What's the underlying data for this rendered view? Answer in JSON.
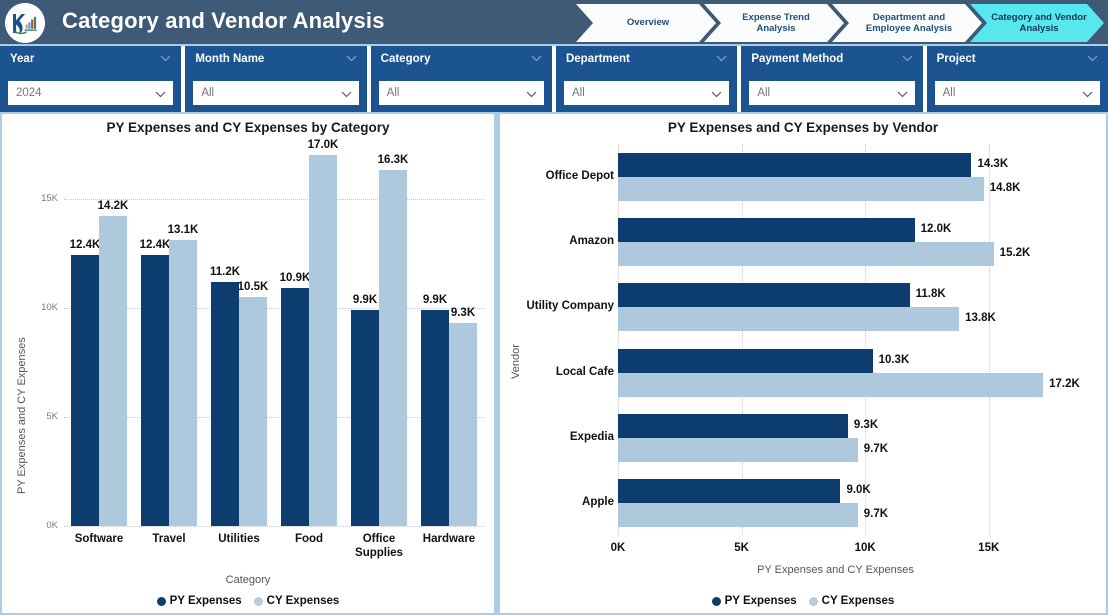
{
  "header": {
    "title": "Category and Vendor Analysis",
    "logo_icon": "kr-analytics-logo-icon",
    "background": "#3f5a77"
  },
  "nav": {
    "tabs": [
      {
        "label": "Overview",
        "active": false
      },
      {
        "label": "Expense Trend\nAnalysis",
        "active": false
      },
      {
        "label": "Department and\nEmployee Analysis",
        "active": false
      },
      {
        "label": "Category and\nVendor Analysis",
        "active": true
      }
    ],
    "active_color": "#56e8ee",
    "inactive_color": "#fbfcfc"
  },
  "slicers": [
    {
      "name": "year",
      "title": "Year",
      "value": "2024",
      "placeholder": "All",
      "chevron_icon": "chevron-down-icon"
    },
    {
      "name": "month-name",
      "title": "Month Name",
      "value": "All",
      "placeholder": "All",
      "chevron_icon": "chevron-down-icon"
    },
    {
      "name": "category",
      "title": "Category",
      "value": "All",
      "placeholder": "All",
      "chevron_icon": "chevron-down-icon"
    },
    {
      "name": "department",
      "title": "Department",
      "value": "All",
      "placeholder": "All",
      "chevron_icon": "chevron-down-icon"
    },
    {
      "name": "payment-method",
      "title": "Payment Method",
      "value": "All",
      "placeholder": "All",
      "chevron_icon": "chevron-down-icon"
    },
    {
      "name": "project",
      "title": "Project",
      "value": "All",
      "placeholder": "All",
      "chevron_icon": "chevron-down-icon"
    }
  ],
  "colors": {
    "py_series": "#0d3c6e",
    "cy_series": "#aec8de",
    "slicer_card": "#1b5491",
    "page_background": "#aecce4"
  },
  "chart_data": [
    {
      "type": "bar",
      "orientation": "vertical",
      "title": "PY Expenses and CY Expenses by Category",
      "xlabel": "Category",
      "ylabel": "PY Expenses and CY Expenses",
      "categories": [
        "Software",
        "Travel",
        "Utilities",
        "Food",
        "Office Supplies",
        "Hardware"
      ],
      "series": [
        {
          "name": "PY Expenses",
          "color": "#0d3c6e",
          "values": [
            12400,
            12400,
            11200,
            10900,
            9900,
            9900
          ],
          "labels": [
            "12.4K",
            "12.4K",
            "11.2K",
            "10.9K",
            "9.9K",
            "9.9K"
          ]
        },
        {
          "name": "CY Expenses",
          "color": "#aec8de",
          "values": [
            14200,
            13100,
            10500,
            17000,
            16300,
            9300
          ],
          "labels": [
            "14.2K",
            "13.1K",
            "10.5K",
            "17.0K",
            "16.3K",
            "9.3K"
          ]
        }
      ],
      "ylim": [
        0,
        17600
      ],
      "yticks": [
        0,
        5000,
        10000,
        15000
      ],
      "ytick_labels": [
        "0K",
        "5K",
        "10K",
        "15K"
      ],
      "grid": true,
      "legend_position": "bottom"
    },
    {
      "type": "bar",
      "orientation": "horizontal",
      "title": "PY Expenses and CY Expenses by Vendor",
      "xlabel": "PY Expenses and CY Expenses",
      "ylabel": "Vendor",
      "categories": [
        "Office Depot",
        "Amazon",
        "Utility Company",
        "Local Cafe",
        "Expedia",
        "Apple"
      ],
      "series": [
        {
          "name": "PY Expenses",
          "color": "#0d3c6e",
          "values": [
            14300,
            12000,
            11800,
            10300,
            9300,
            9000
          ],
          "labels": [
            "14.3K",
            "12.0K",
            "11.8K",
            "10.3K",
            "9.3K",
            "9.0K"
          ]
        },
        {
          "name": "CY Expenses",
          "color": "#aec8de",
          "values": [
            14800,
            15200,
            13800,
            17200,
            9700,
            9700
          ],
          "labels": [
            "14.8K",
            "15.2K",
            "13.8K",
            "17.2K",
            "9.7K",
            "9.7K"
          ]
        }
      ],
      "xlim": [
        0,
        17600
      ],
      "xticks": [
        0,
        5000,
        10000,
        15000
      ],
      "xtick_labels": [
        "0K",
        "5K",
        "10K",
        "15K"
      ],
      "grid": true,
      "legend_position": "bottom"
    }
  ]
}
